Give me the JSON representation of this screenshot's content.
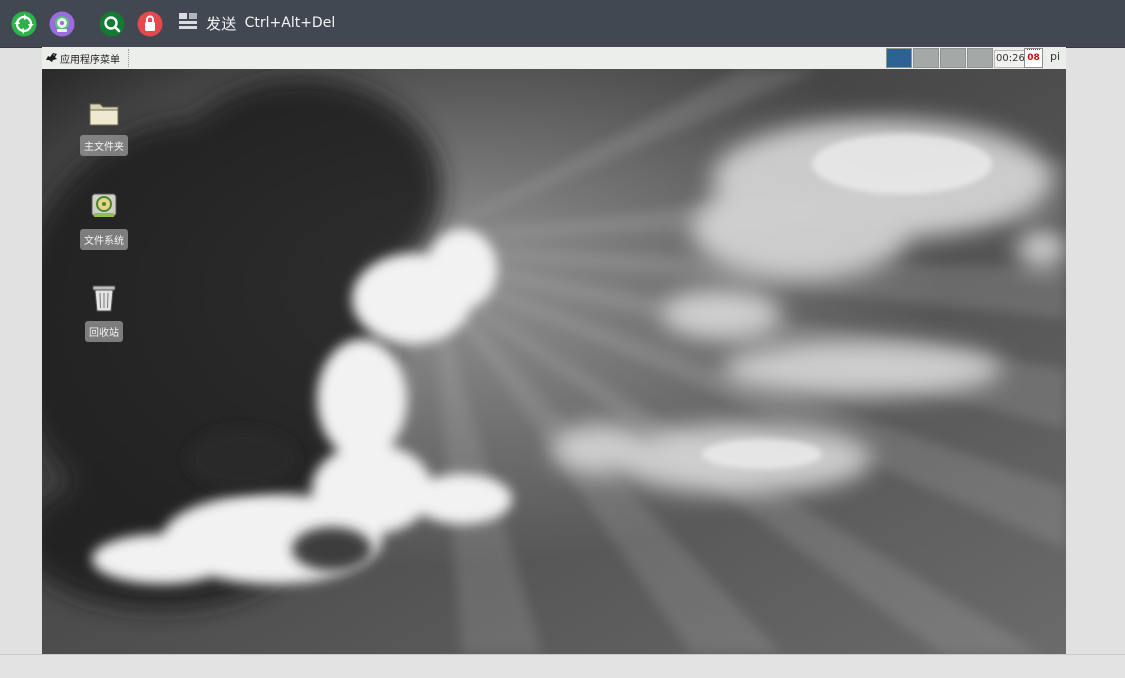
{
  "toolbar": {
    "send_label": "发送",
    "send_combo": "Ctrl+Alt+Del",
    "buttons": [
      {
        "name": "reconnect-icon",
        "color": "#2bb34a"
      },
      {
        "name": "media-icon",
        "color": "#9b6ce0"
      },
      {
        "name": "search-icon",
        "color": "#1c9b3d"
      },
      {
        "name": "lock-icon",
        "color": "#e5484d"
      },
      {
        "name": "screen-layout-icon",
        "color": "#cfd4da"
      }
    ]
  },
  "remote": {
    "taskbar": {
      "menu_label": "应用程序菜单",
      "workspaces": [
        "#2c6293",
        "#a4a8a6",
        "#a4a8a6",
        "#a4a8a6"
      ],
      "clock": "00:26",
      "calendar_day": "08",
      "user": "pi"
    },
    "desktop_icons": [
      {
        "label": "主文件夹",
        "icon": "folder-icon"
      },
      {
        "label": "文件系统",
        "icon": "filesystem-icon"
      },
      {
        "label": "回收站",
        "icon": "trash-icon"
      }
    ]
  }
}
